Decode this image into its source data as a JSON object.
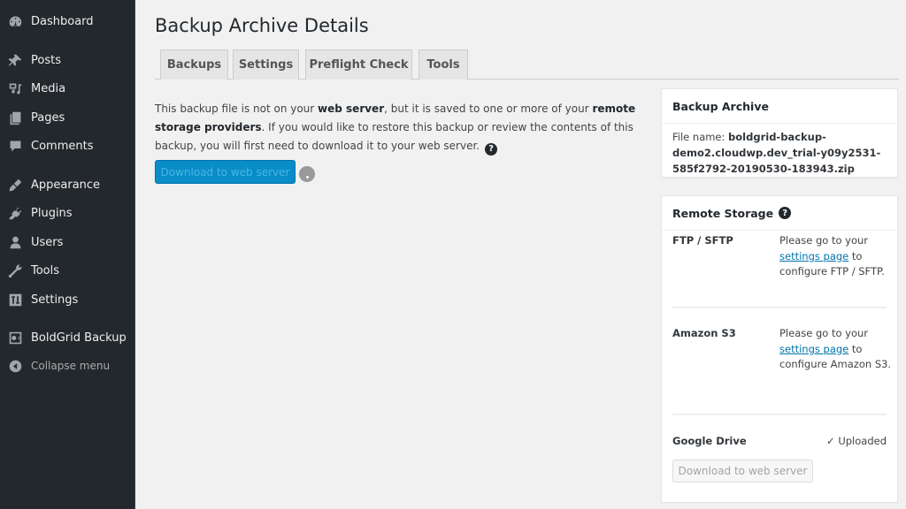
{
  "sidebar": {
    "items": [
      {
        "label": "Dashboard",
        "icon": "dashboard-icon"
      },
      {
        "label": "Posts",
        "icon": "pin-icon"
      },
      {
        "label": "Media",
        "icon": "media-icon"
      },
      {
        "label": "Pages",
        "icon": "pages-icon"
      },
      {
        "label": "Comments",
        "icon": "comment-icon"
      },
      {
        "label": "Appearance",
        "icon": "paintbrush-icon"
      },
      {
        "label": "Plugins",
        "icon": "plugin-icon"
      },
      {
        "label": "Users",
        "icon": "user-icon"
      },
      {
        "label": "Tools",
        "icon": "wrench-icon"
      },
      {
        "label": "Settings",
        "icon": "settings-icon"
      },
      {
        "label": "BoldGrid Backup",
        "icon": "vault-icon"
      },
      {
        "label": "Collapse menu",
        "icon": "collapse-arrow-icon"
      }
    ]
  },
  "page": {
    "title": "Backup Archive Details",
    "tabs": [
      {
        "label": "Backups"
      },
      {
        "label": "Settings"
      },
      {
        "label": "Preflight Check"
      },
      {
        "label": "Tools"
      }
    ]
  },
  "notice": {
    "part1": "This backup file is not on your ",
    "bold1": "web server",
    "part2": ", but it is saved to one or more of your ",
    "bold2": "remote storage providers",
    "part3": ". If you would like to restore this backup or review the contents of this backup, you will first need to download it to your web server.",
    "help": "?"
  },
  "download_button": "Download to web server",
  "archive_box": {
    "title": "Backup Archive",
    "file_label": "File name: ",
    "file_name": "boldgrid-backup-demo2.cloudwp.dev_trial-y09y2531-585f2792-20190530-183943.zip"
  },
  "storage_box": {
    "title": "Remote Storage",
    "help": "?",
    "providers": [
      {
        "name": "FTP / SFTP",
        "pre": "Please go to your ",
        "link": "settings page",
        "post": " to configure FTP / SFTP."
      },
      {
        "name": "Amazon S3",
        "pre": "Please go to your ",
        "link": "settings page",
        "post": " to configure Amazon S3."
      },
      {
        "name": "Google Drive",
        "status": "✓ Uploaded",
        "button": "Download to web server"
      }
    ]
  }
}
